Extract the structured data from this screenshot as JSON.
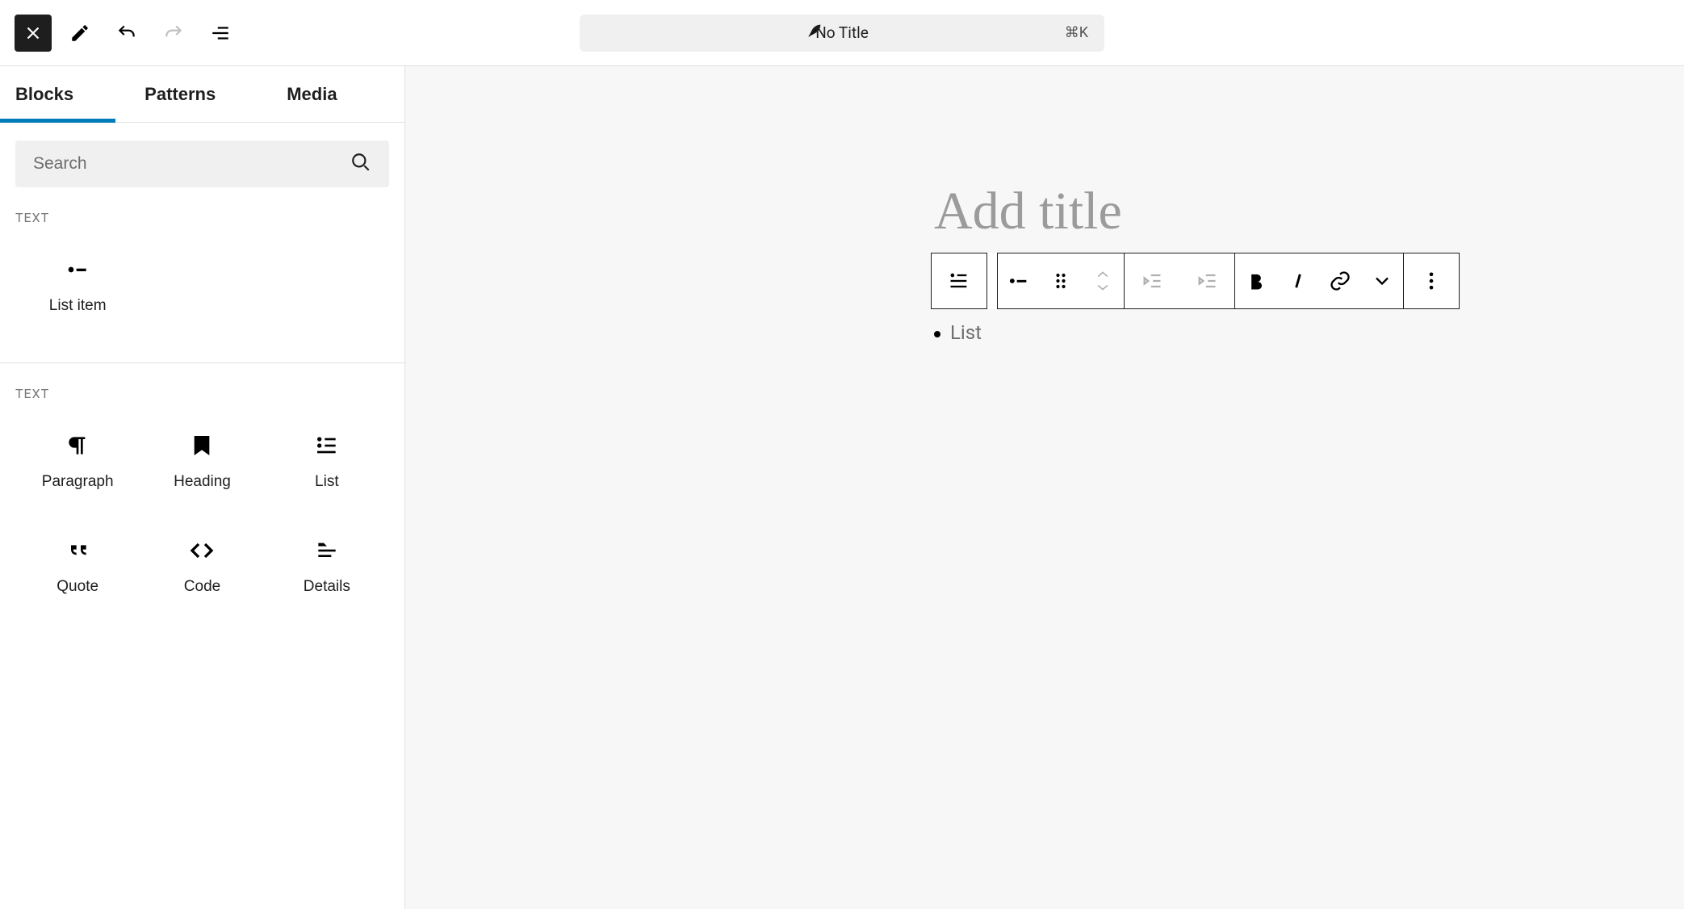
{
  "header": {
    "title": "No Title",
    "shortcut": "⌘K"
  },
  "sidebar": {
    "tabs": [
      "Blocks",
      "Patterns",
      "Media"
    ],
    "active_tab_index": 0,
    "search_placeholder": "Search",
    "sections": [
      {
        "label": "TEXT",
        "blocks": [
          {
            "label": "List item",
            "icon": "list-item-icon"
          }
        ]
      },
      {
        "label": "TEXT",
        "blocks": [
          {
            "label": "Paragraph",
            "icon": "paragraph-icon"
          },
          {
            "label": "Heading",
            "icon": "heading-icon"
          },
          {
            "label": "List",
            "icon": "list-icon"
          },
          {
            "label": "Quote",
            "icon": "quote-icon"
          },
          {
            "label": "Code",
            "icon": "code-icon"
          },
          {
            "label": "Details",
            "icon": "details-icon"
          }
        ]
      }
    ]
  },
  "canvas": {
    "title_placeholder": "Add title",
    "list_item_placeholder": "List"
  }
}
